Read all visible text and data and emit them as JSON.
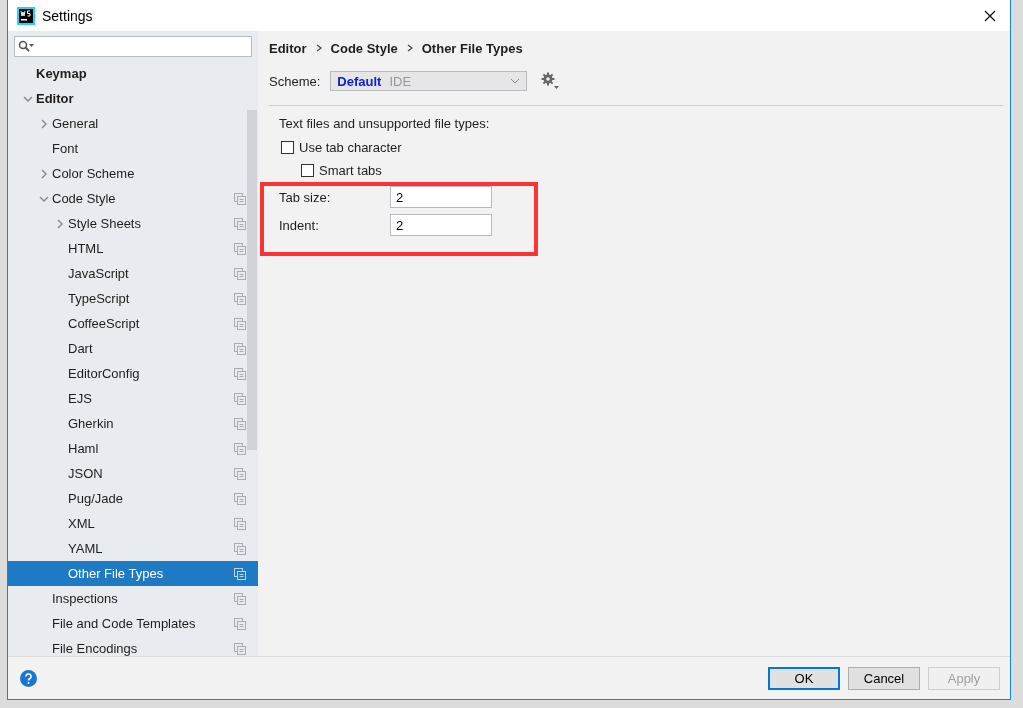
{
  "window": {
    "title": "Settings"
  },
  "tree": [
    {
      "label": "Keymap",
      "kind": "leaf",
      "selected": false,
      "scoped": false
    },
    {
      "label": "Editor",
      "kind": "node",
      "expanded": true,
      "selected": false,
      "scoped": false,
      "children": [
        {
          "label": "General",
          "kind": "node",
          "expanded": false,
          "selected": false,
          "scoped": false
        },
        {
          "label": "Font",
          "kind": "leaf",
          "selected": false,
          "scoped": false
        },
        {
          "label": "Color Scheme",
          "kind": "node",
          "expanded": false,
          "selected": false,
          "scoped": false
        },
        {
          "label": "Code Style",
          "kind": "node",
          "expanded": true,
          "selected": false,
          "scoped": true,
          "children": [
            {
              "label": "Style Sheets",
              "kind": "node",
              "expanded": false,
              "selected": false,
              "scoped": true
            },
            {
              "label": "HTML",
              "kind": "leaf",
              "selected": false,
              "scoped": true
            },
            {
              "label": "JavaScript",
              "kind": "leaf",
              "selected": false,
              "scoped": true
            },
            {
              "label": "TypeScript",
              "kind": "leaf",
              "selected": false,
              "scoped": true
            },
            {
              "label": "CoffeeScript",
              "kind": "leaf",
              "selected": false,
              "scoped": true
            },
            {
              "label": "Dart",
              "kind": "leaf",
              "selected": false,
              "scoped": true
            },
            {
              "label": "EditorConfig",
              "kind": "leaf",
              "selected": false,
              "scoped": true
            },
            {
              "label": "EJS",
              "kind": "leaf",
              "selected": false,
              "scoped": true
            },
            {
              "label": "Gherkin",
              "kind": "leaf",
              "selected": false,
              "scoped": true
            },
            {
              "label": "Haml",
              "kind": "leaf",
              "selected": false,
              "scoped": true
            },
            {
              "label": "JSON",
              "kind": "leaf",
              "selected": false,
              "scoped": true
            },
            {
              "label": "Pug/Jade",
              "kind": "leaf",
              "selected": false,
              "scoped": true
            },
            {
              "label": "XML",
              "kind": "leaf",
              "selected": false,
              "scoped": true
            },
            {
              "label": "YAML",
              "kind": "leaf",
              "selected": false,
              "scoped": true
            },
            {
              "label": "Other File Types",
              "kind": "leaf",
              "selected": true,
              "scoped": true
            }
          ]
        },
        {
          "label": "Inspections",
          "kind": "leaf",
          "selected": false,
          "scoped": true
        },
        {
          "label": "File and Code Templates",
          "kind": "leaf",
          "selected": false,
          "scoped": true
        },
        {
          "label": "File Encodings",
          "kind": "leaf",
          "selected": false,
          "scoped": true
        }
      ]
    }
  ],
  "breadcrumb": [
    "Editor",
    "Code Style",
    "Other File Types"
  ],
  "scheme": {
    "label": "Scheme:",
    "name": "Default",
    "type": "IDE"
  },
  "section_title": "Text files and unsupported file types:",
  "checkboxes": [
    {
      "label": "Use tab character",
      "checked": false,
      "children": [
        {
          "label": "Smart tabs",
          "checked": false
        }
      ]
    }
  ],
  "fields": [
    {
      "label": "Tab size:",
      "value": "2"
    },
    {
      "label": "Indent:",
      "value": "2"
    }
  ],
  "buttons": [
    {
      "label": "OK",
      "kind": "default",
      "disabled": false
    },
    {
      "label": "Cancel",
      "kind": "normal",
      "disabled": false
    },
    {
      "label": "Apply",
      "kind": "normal",
      "disabled": true
    }
  ]
}
